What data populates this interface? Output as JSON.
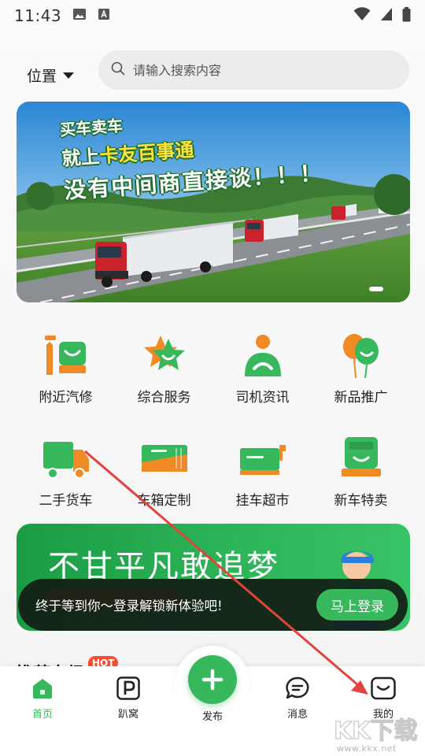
{
  "status_bar": {
    "time": "11:43"
  },
  "header": {
    "location_label": "位置",
    "search_placeholder": "请输入搜索内容"
  },
  "banner": {
    "line1": "买车卖车",
    "line2_prefix": "就上",
    "line2_highlight": "卡友百事通",
    "line3": "没有中间商直接谈！！！"
  },
  "services": [
    {
      "label": "附近汽修",
      "icon": "wrench-truck-icon"
    },
    {
      "label": "综合服务",
      "icon": "star-icon"
    },
    {
      "label": "司机资讯",
      "icon": "driver-icon"
    },
    {
      "label": "新品推广",
      "icon": "balloon-icon"
    },
    {
      "label": "二手货车",
      "icon": "cargo-truck-icon"
    },
    {
      "label": "车箱定制",
      "icon": "container-icon"
    },
    {
      "label": "挂车超市",
      "icon": "trailer-icon"
    },
    {
      "label": "新车特卖",
      "icon": "new-truck-icon"
    }
  ],
  "promo": {
    "title": "不甘平凡敢追梦"
  },
  "login_toast": {
    "text": "终于等到你～登录解锁新体验吧!",
    "button": "马上登录"
  },
  "recommend": {
    "title": "推荐专场",
    "badge": "HOT"
  },
  "bottom_nav": {
    "items": [
      {
        "label": "首页",
        "active": true
      },
      {
        "label": "趴窝"
      },
      {
        "label": "发布"
      },
      {
        "label": "消息"
      },
      {
        "label": "我的"
      }
    ]
  },
  "watermark": {
    "text": "KK下载",
    "url": "www.kkx.net"
  },
  "colors": {
    "accent": "#37b85d",
    "orange": "#f08a24",
    "arrow": "#e0443c"
  }
}
